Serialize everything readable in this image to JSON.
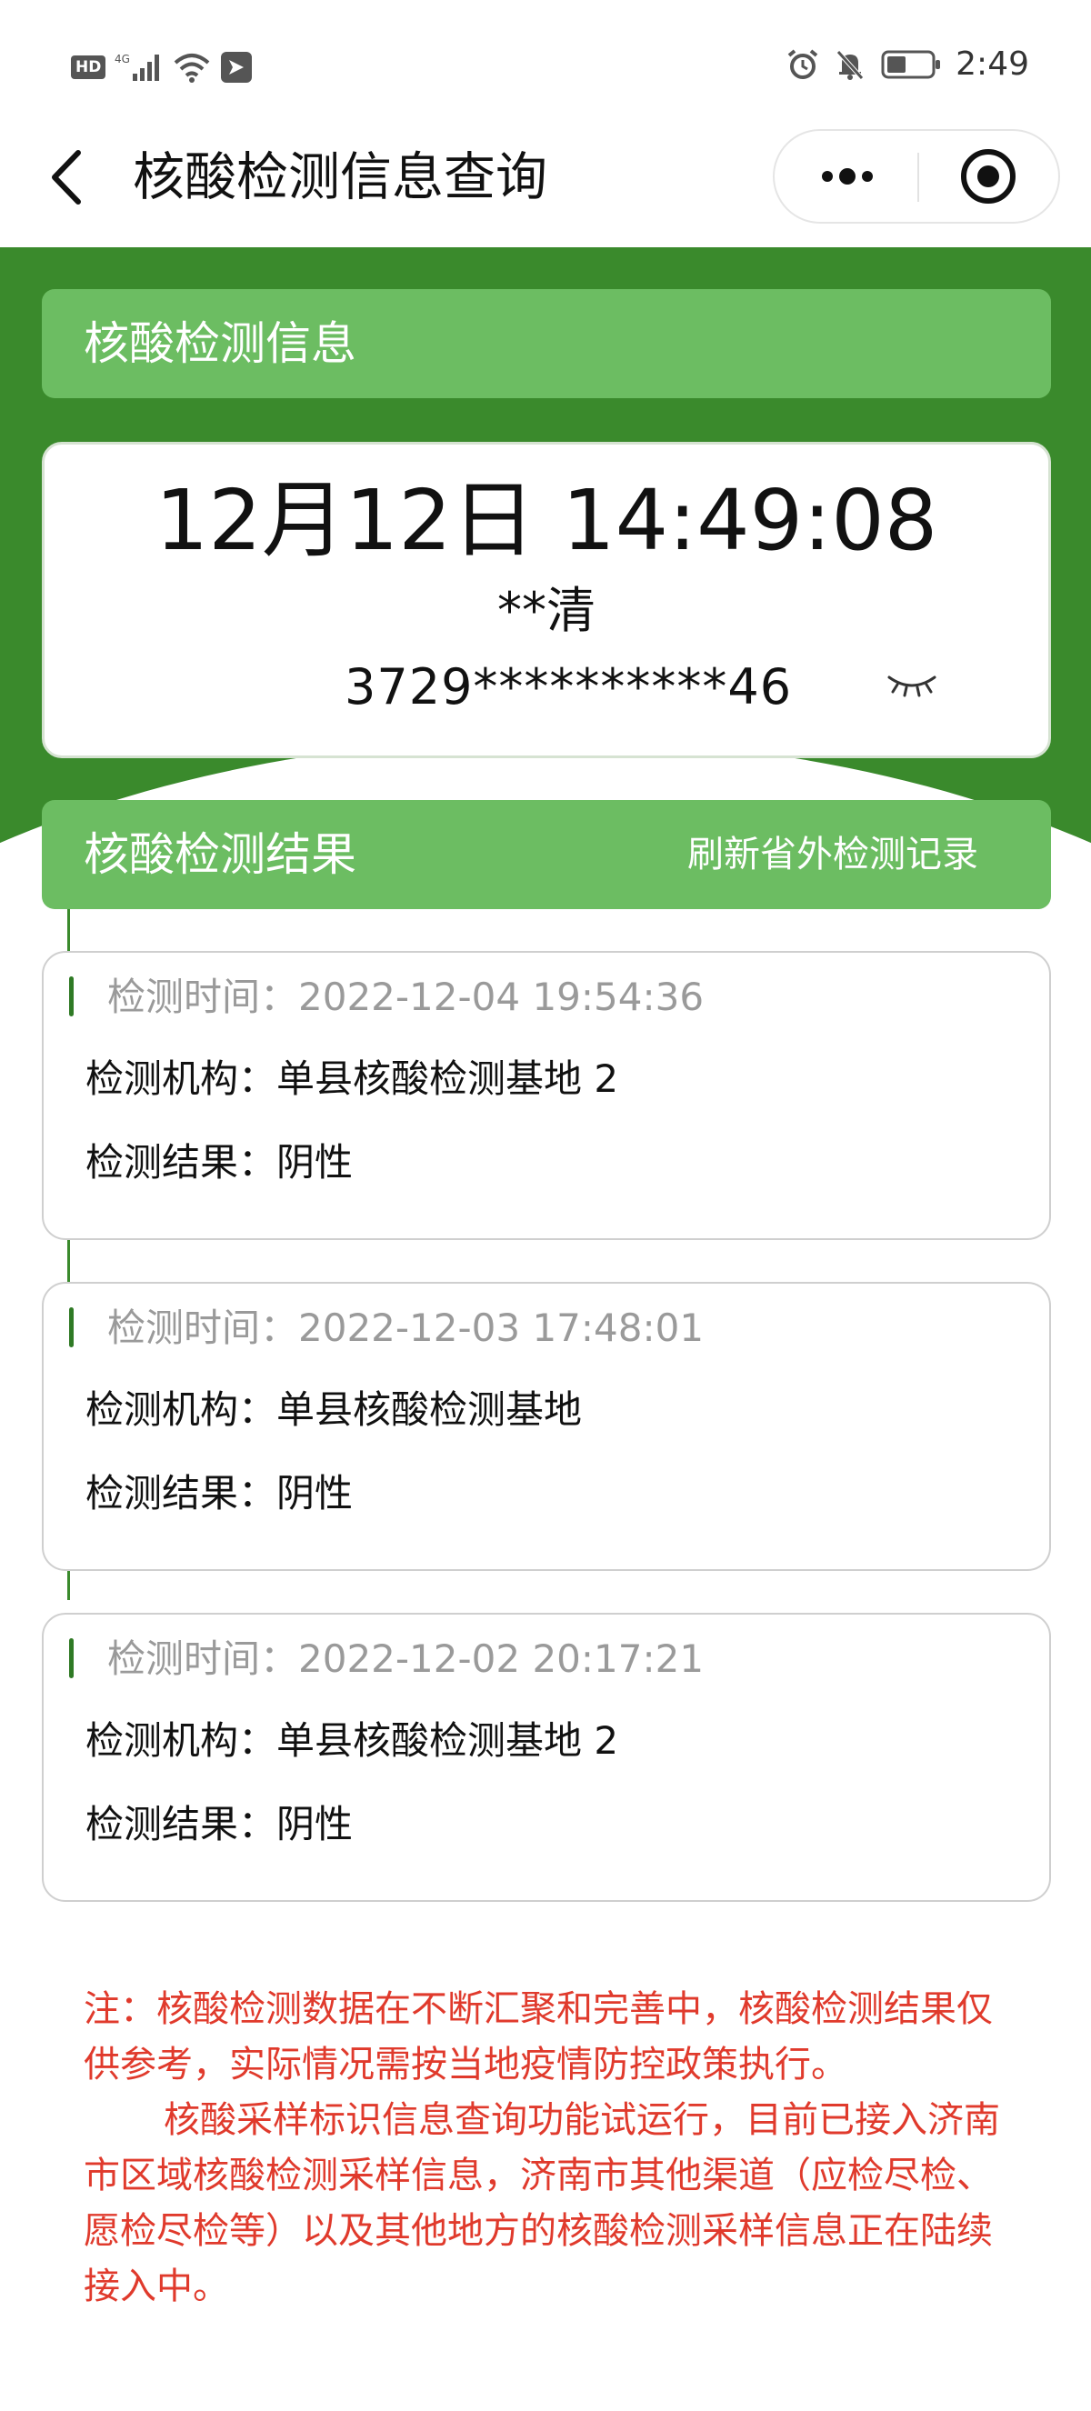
{
  "status_bar": {
    "hd_badge": "HD",
    "network": "4G",
    "time": "2:49"
  },
  "nav": {
    "title": "核酸检测信息查询",
    "back_icon": "chevron-left-icon",
    "more_icon": "more-dots-icon",
    "close_icon": "target-circle-icon"
  },
  "info_section": {
    "header": "核酸检测信息",
    "datetime": "12月12日 14:49:08",
    "name": "**清",
    "id_number": "3729**********46",
    "toggle_icon": "eye-closed-icon"
  },
  "result_section": {
    "header": "核酸检测结果",
    "refresh_label": "刷新省外检测记录"
  },
  "records": [
    {
      "time_label": "检测时间：",
      "time": "2022-12-04 19:54:36",
      "org_label": "检测机构：",
      "org": "单县核酸检测基地 2",
      "result_label": "检测结果：",
      "result": "阴性"
    },
    {
      "time_label": "检测时间：",
      "time": "2022-12-03 17:48:01",
      "org_label": "检测机构：",
      "org": "单县核酸检测基地",
      "result_label": "检测结果：",
      "result": "阴性"
    },
    {
      "time_label": "检测时间：",
      "time": "2022-12-02 20:17:21",
      "org_label": "检测机构：",
      "org": "单县核酸检测基地 2",
      "result_label": "检测结果：",
      "result": "阴性"
    }
  ],
  "notes": {
    "note1": "注：核酸检测数据在不断汇聚和完善中，核酸检测结果仅供参考，实际情况需按当地疫情防控政策执行。",
    "note2": "核酸采样标识信息查询功能试运行，目前已接入济南市区域核酸检测采样信息，济南市其他渠道（应检尽检、愿检尽检等）以及其他地方的核酸检测采样信息正在陆续接入中。"
  },
  "colors": {
    "green_dark": "#3a8a2c",
    "green_light": "#6cbd62",
    "note_red": "#e03a2c"
  }
}
